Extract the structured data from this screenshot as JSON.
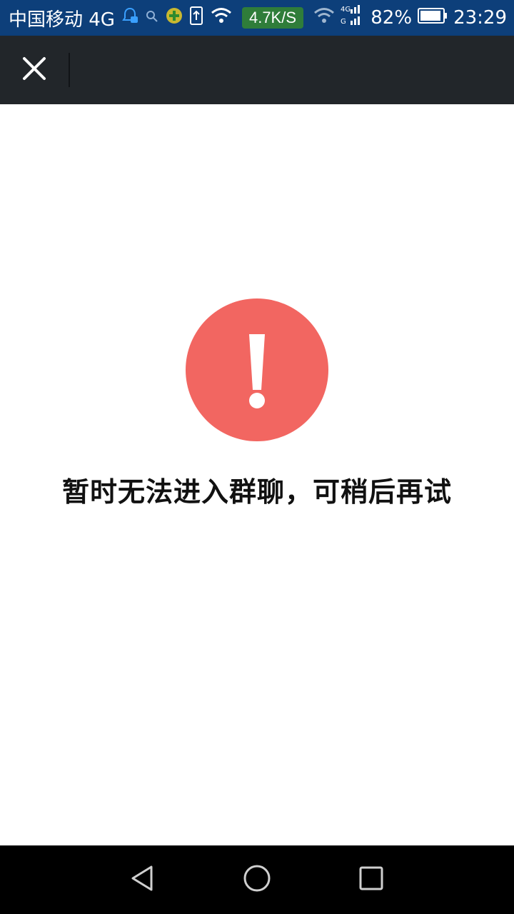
{
  "status_bar": {
    "carrier": "中国移动 4G",
    "net_speed": "4.7K/S",
    "network_type": "4G",
    "battery": "82%",
    "time": "23:29"
  },
  "app_bar": {
    "close_icon": "close-icon"
  },
  "error": {
    "icon": "exclamation-icon",
    "icon_color": "#f26661",
    "message": "暂时无法进入群聊，可稍后再试"
  },
  "nav_bar": {
    "buttons": [
      "back-icon",
      "home-icon",
      "recents-icon"
    ]
  }
}
